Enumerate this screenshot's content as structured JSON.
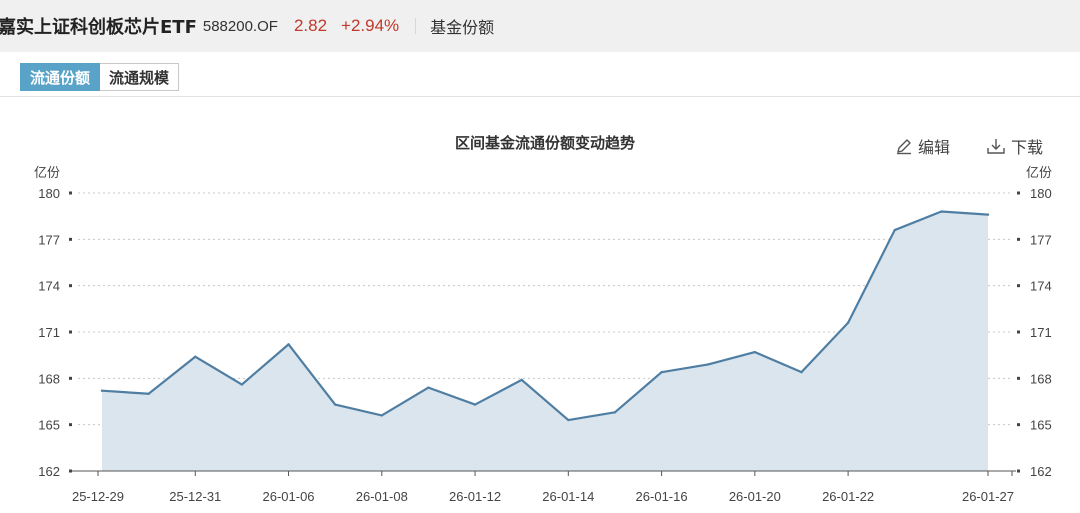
{
  "header": {
    "fund_name": "嘉实上证科创板芯片ETF",
    "fund_code": "588200.OF",
    "price": "2.82",
    "change": "+2.94%",
    "section": "基金份额"
  },
  "tabs": [
    {
      "label": "流通份额",
      "active": true
    },
    {
      "label": "流通规模",
      "active": false
    }
  ],
  "toolbar": {
    "edit_label": "编辑",
    "download_label": "下载"
  },
  "colors": {
    "line": "#4f7ea3",
    "area": "#dbe5ee",
    "accent": "#5aa3c8",
    "change": "#c0392b"
  },
  "chart_data": {
    "type": "area",
    "title": "区间基金流通份额变动趋势",
    "ylabel_left": "亿份",
    "ylabel_right": "亿份",
    "ylim": [
      162,
      180
    ],
    "yticks": [
      162,
      165,
      168,
      171,
      174,
      177,
      180
    ],
    "grid": true,
    "x_tick_labels": [
      "25-12-29",
      "25-12-31",
      "26-01-06",
      "26-01-08",
      "26-01-12",
      "26-01-14",
      "26-01-16",
      "26-01-20",
      "26-01-22",
      "26-01-27"
    ],
    "series": [
      {
        "name": "流通份额",
        "x": [
          "25-12-29",
          "25-12-30",
          "25-12-31",
          "26-01-05",
          "26-01-06",
          "26-01-07",
          "26-01-08",
          "26-01-09",
          "26-01-12",
          "26-01-13",
          "26-01-14",
          "26-01-15",
          "26-01-16",
          "26-01-19",
          "26-01-20",
          "26-01-21",
          "26-01-22",
          "26-01-23",
          "26-01-26",
          "26-01-27"
        ],
        "values": [
          167.2,
          167.0,
          169.4,
          167.6,
          170.2,
          166.3,
          165.6,
          167.4,
          166.3,
          167.9,
          165.3,
          165.8,
          168.4,
          168.9,
          169.7,
          168.4,
          171.6,
          177.6,
          178.8,
          178.6
        ]
      }
    ]
  }
}
